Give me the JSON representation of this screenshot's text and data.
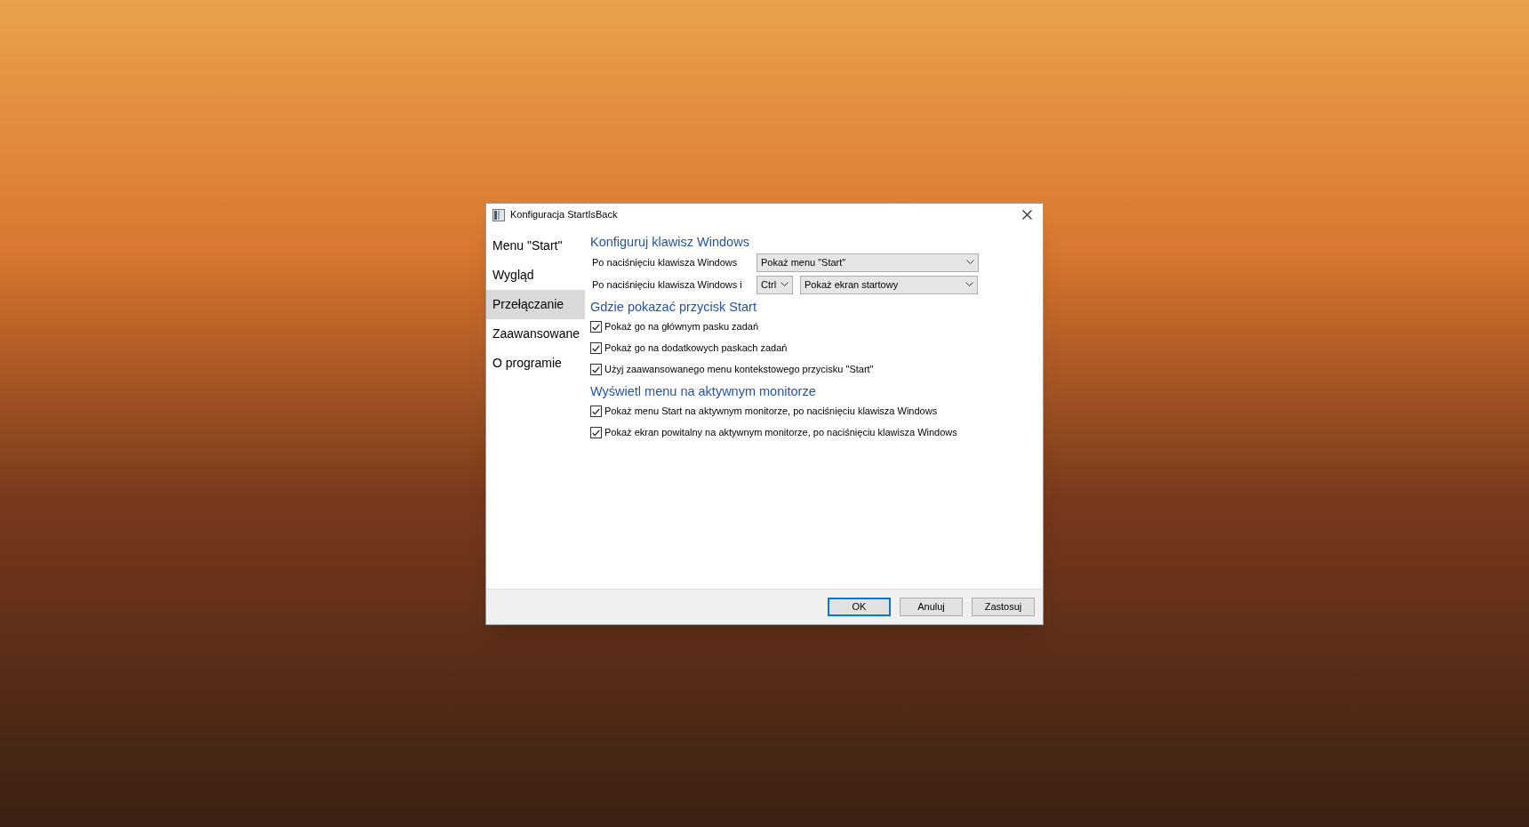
{
  "window": {
    "title": "Konfiguracja StartIsBack"
  },
  "sidebar": {
    "items": [
      {
        "label": "Menu \"Start\"",
        "selected": false
      },
      {
        "label": "Wygląd",
        "selected": false
      },
      {
        "label": "Przełączanie",
        "selected": true
      },
      {
        "label": "Zaawansowane",
        "selected": false
      },
      {
        "label": "O programie",
        "selected": false
      }
    ]
  },
  "sections": [
    {
      "heading": "Konfiguruj klawisz Windows",
      "items": [
        {
          "kind": "dropdowns",
          "label": "Po naciśnięciu klawisza Windows",
          "selects": [
            {
              "value": "Pokaż menu \"Start\""
            }
          ]
        },
        {
          "kind": "dropdowns",
          "label": "Po naciśnięciu klawisza Windows i",
          "selects": [
            {
              "value": "Ctrl"
            },
            {
              "value": "Pokaż ekran startowy"
            }
          ]
        }
      ]
    },
    {
      "heading": "Gdzie pokazać przycisk Start",
      "items": [
        {
          "kind": "checkbox",
          "label": "Pokaż go na głównym pasku zadań",
          "checked": true
        },
        {
          "kind": "checkbox",
          "label": "Pokaż go na dodatkowych paskach zadań",
          "checked": true
        },
        {
          "kind": "checkbox",
          "label": "Użyj zaawansowanego menu kontekstowego przycisku \"Start\"",
          "checked": true
        }
      ]
    },
    {
      "heading": "Wyświetl menu na aktywnym monitorze",
      "items": [
        {
          "kind": "checkbox",
          "label": "Pokaż menu Start na aktywnym monitorze, po naciśnięciu klawisza Windows",
          "checked": true
        },
        {
          "kind": "checkbox",
          "label": "Pokaż ekran powitalny na aktywnym monitorze, po naciśnięciu klawisza Windows",
          "checked": true
        }
      ]
    }
  ],
  "buttons": [
    {
      "label": "OK",
      "default": true
    },
    {
      "label": "Anuluj",
      "default": false
    },
    {
      "label": "Zastosuj",
      "default": false
    }
  ]
}
